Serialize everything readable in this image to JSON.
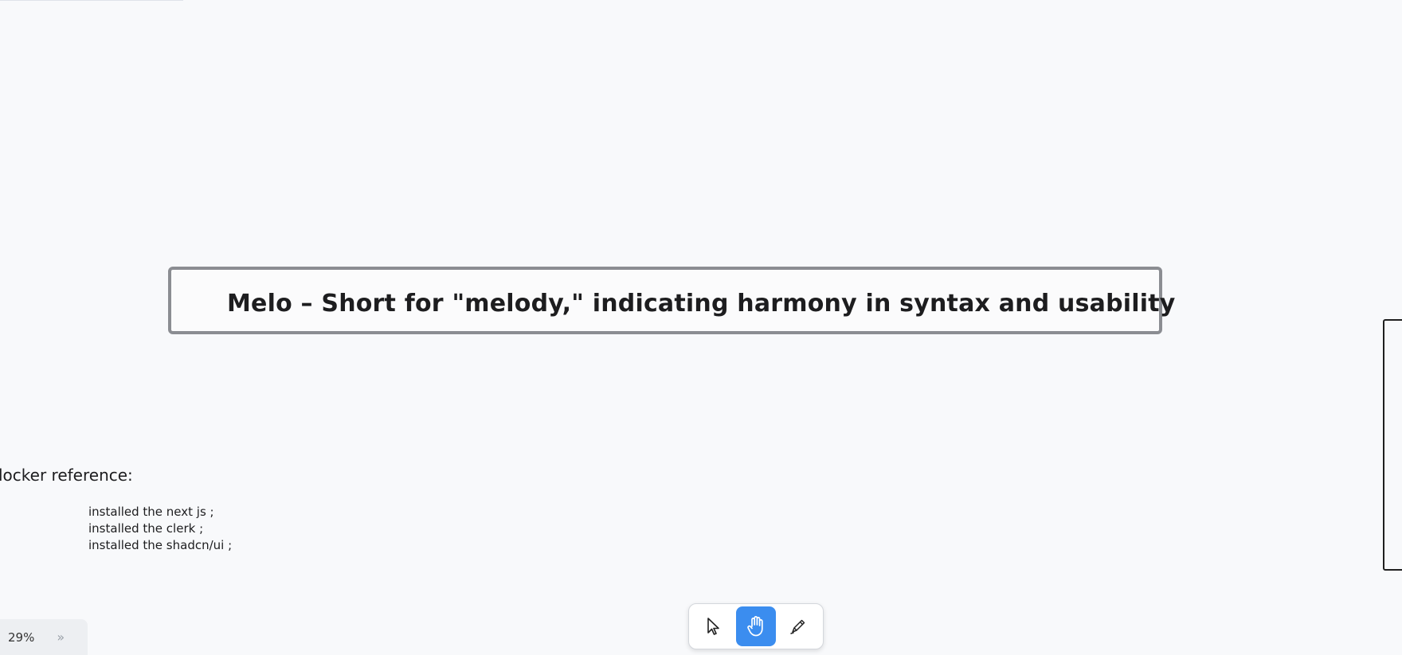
{
  "canvas": {
    "title_card": "Melo – Short for \"melody,\" indicating harmony in syntax and usability",
    "reference_heading": "locker reference:",
    "notes": [
      "installed the next js ;",
      "installed the clerk ;",
      "installed the shadcn/ui ;"
    ]
  },
  "toolbar": {
    "tools": [
      {
        "name": "select",
        "icon": "cursor-icon",
        "active": false
      },
      {
        "name": "hand",
        "icon": "hand-icon",
        "active": true
      },
      {
        "name": "draw",
        "icon": "pen-icon",
        "active": false
      }
    ],
    "active_color": "#3b8def"
  },
  "zoom": {
    "level": "29%",
    "expand_glyph": "››"
  }
}
